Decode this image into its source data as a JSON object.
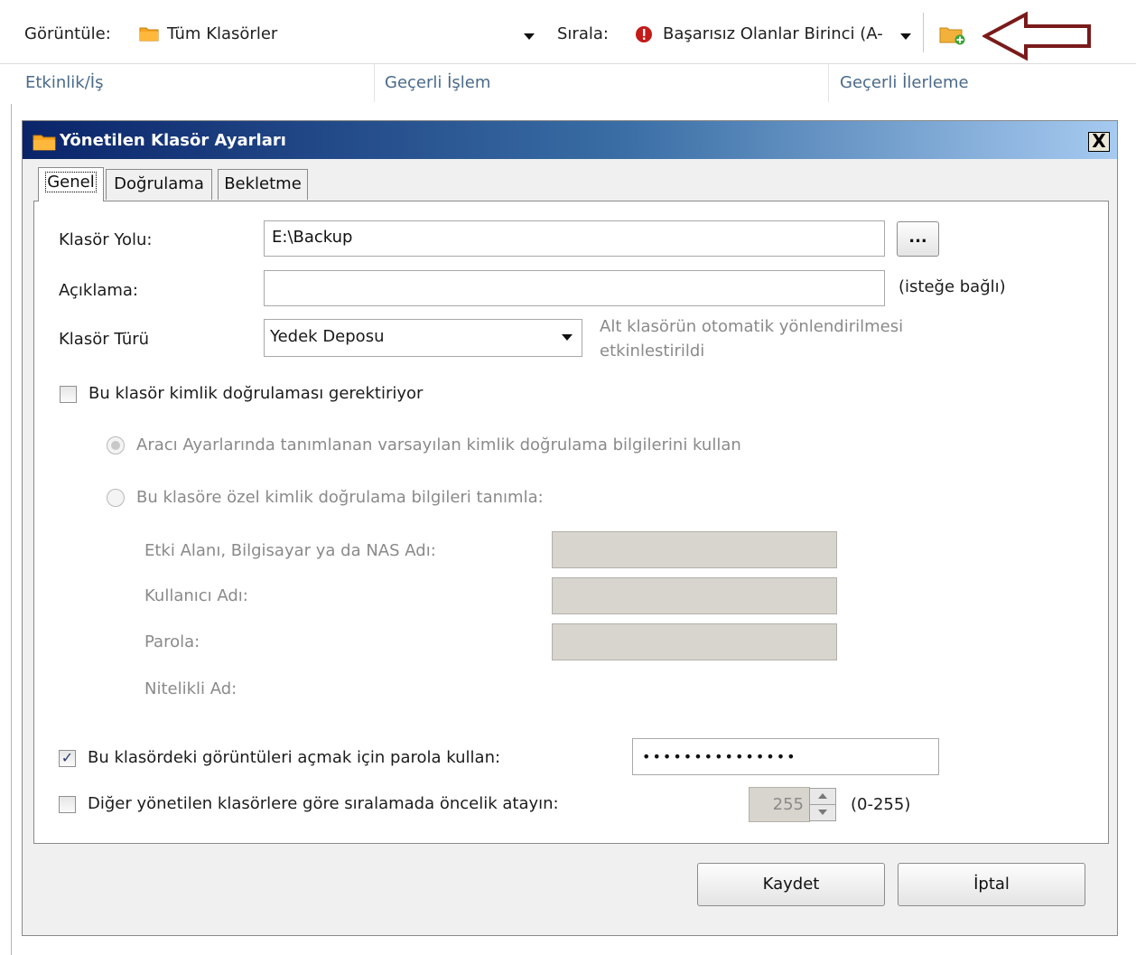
{
  "toolbar": {
    "view_label": "Görüntüle:",
    "view_value": "Tüm Klasörler",
    "sort_label": "Sırala:",
    "sort_value": "Başarısız Olanlar Birinci (A-"
  },
  "columns": [
    "Etkinlik/İş",
    "Geçerli İşlem",
    "Geçerli İlerleme"
  ],
  "dialog": {
    "title": "Yönetilen Klasör Ayarları",
    "close_label": "X",
    "tabs": [
      "Genel",
      "Doğrulama",
      "Bekletme"
    ],
    "folder_path_label": "Klasör Yolu:",
    "folder_path_value": "E:\\Backup",
    "browse_label": "...",
    "description_label": "Açıklama:",
    "description_value": "",
    "optional_note": "(isteğe bağlı)",
    "folder_type_label": "Klasör Türü",
    "folder_type_value": "Yedek Deposu",
    "folder_type_note_line1": "Alt klasörün otomatik yönlendirilmesi",
    "folder_type_note_line2": "etkinlestirildi",
    "auth_required_label": "Bu klasör kimlik doğrulaması gerektiriyor",
    "auth_required_checked": false,
    "radio_default_label": "Aracı Ayarlarında tanımlanan varsayılan kimlik doğrulama bilgilerini kullan",
    "radio_custom_label": "Bu klasöre özel kimlik doğrulama bilgileri tanımla:",
    "domain_label": "Etki Alanı, Bilgisayar ya da NAS Adı:",
    "username_label": "Kullanıcı Adı:",
    "password_label": "Parola:",
    "qualified_name_label": "Nitelikli Ad:",
    "image_password_label": "Bu klasördeki görüntüleri açmak için parola kullan:",
    "image_password_checked": true,
    "image_password_value": "•••••••••••••••",
    "priority_label": "Diğer yönetilen klasörlere göre sıralamada öncelik atayın:",
    "priority_checked": false,
    "priority_value": "255",
    "priority_range": "(0-255)",
    "save_label": "Kaydet",
    "cancel_label": "İptal"
  },
  "colors": {
    "title_gradient_start": "#0a246a",
    "title_gradient_end": "#a6caf0",
    "annotation_arrow": "#7a1a1a"
  }
}
